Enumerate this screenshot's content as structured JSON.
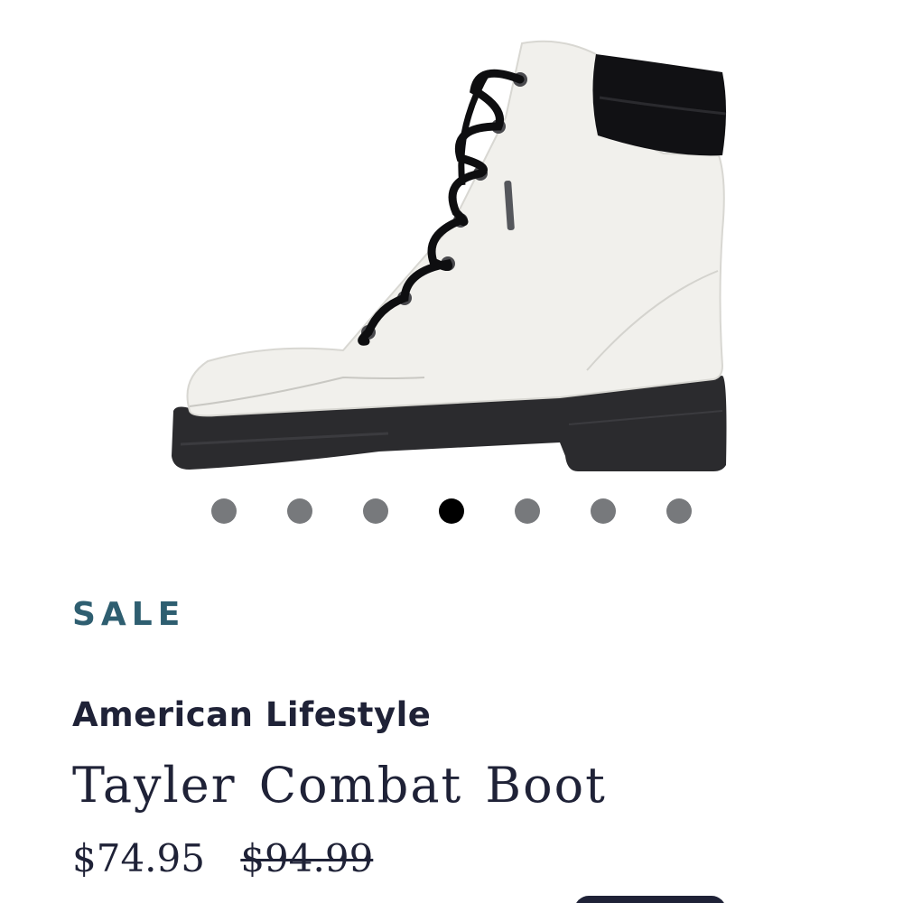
{
  "product": {
    "badge": "SALE",
    "brand": "American Lifestyle",
    "name": "Tayler Combat Boot",
    "price_sale": "$74.95",
    "price_original": "$94.99",
    "image_alt": "Tayler Combat Boot white side view"
  },
  "carousel": {
    "total": 7,
    "active_index": 3
  },
  "colors": {
    "badge": "#2e5e70",
    "text": "#1f2237",
    "dot_inactive": "#77797c",
    "dot_active": "#000000"
  }
}
